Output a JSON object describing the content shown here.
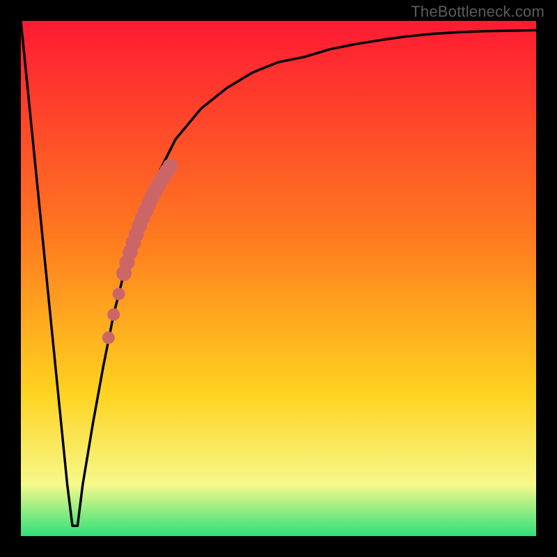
{
  "watermark": "TheBottleneck.com",
  "chart_data": {
    "type": "line",
    "title": "",
    "xlabel": "",
    "ylabel": "",
    "xlim": [
      0,
      100
    ],
    "ylim": [
      0,
      100
    ],
    "grid": false,
    "legend": false,
    "annotations": [],
    "background_gradient_note": "vertical gradient red→orange→yellow→pale-yellow→green (top→bottom)",
    "series": [
      {
        "name": "bottleneck-curve",
        "type": "line",
        "x": [
          0,
          2,
          4,
          6,
          8,
          9,
          10,
          11,
          12,
          14,
          16,
          18,
          20,
          22,
          24,
          26,
          28,
          30,
          35,
          40,
          45,
          50,
          55,
          60,
          65,
          70,
          75,
          80,
          85,
          90,
          95,
          100
        ],
        "y": [
          100,
          80,
          60,
          40,
          20,
          10,
          2,
          2,
          10,
          22,
          33,
          43,
          51,
          58,
          64,
          69,
          73,
          77,
          83,
          87,
          90,
          92,
          93,
          94.5,
          95.5,
          96.3,
          97,
          97.5,
          97.8,
          98,
          98.1,
          98.2
        ]
      },
      {
        "name": "highlight-band",
        "type": "scatter",
        "x": [
          20.0,
          20.6,
          21.2,
          21.8,
          22.4,
          23.0,
          23.6,
          24.2,
          24.8,
          25.4,
          26.0,
          26.6,
          27.2,
          27.8,
          28.4,
          29.0
        ],
        "y": [
          51.0,
          53.1,
          55.1,
          56.9,
          58.6,
          60.2,
          61.7,
          63.1,
          64.4,
          65.7,
          66.9,
          68.0,
          69.0,
          70.0,
          70.9,
          71.8
        ]
      },
      {
        "name": "highlight-dots",
        "type": "scatter",
        "x": [
          17.0,
          18.0,
          19.0
        ],
        "y": [
          38.5,
          43.0,
          47.0
        ]
      }
    ],
    "colors": {
      "curve": "#000000",
      "highlight": "#cc6666",
      "gradient": [
        "#ff1a33",
        "#ff7a1f",
        "#ffd21f",
        "#f6f98a",
        "#2fe07a"
      ]
    }
  }
}
